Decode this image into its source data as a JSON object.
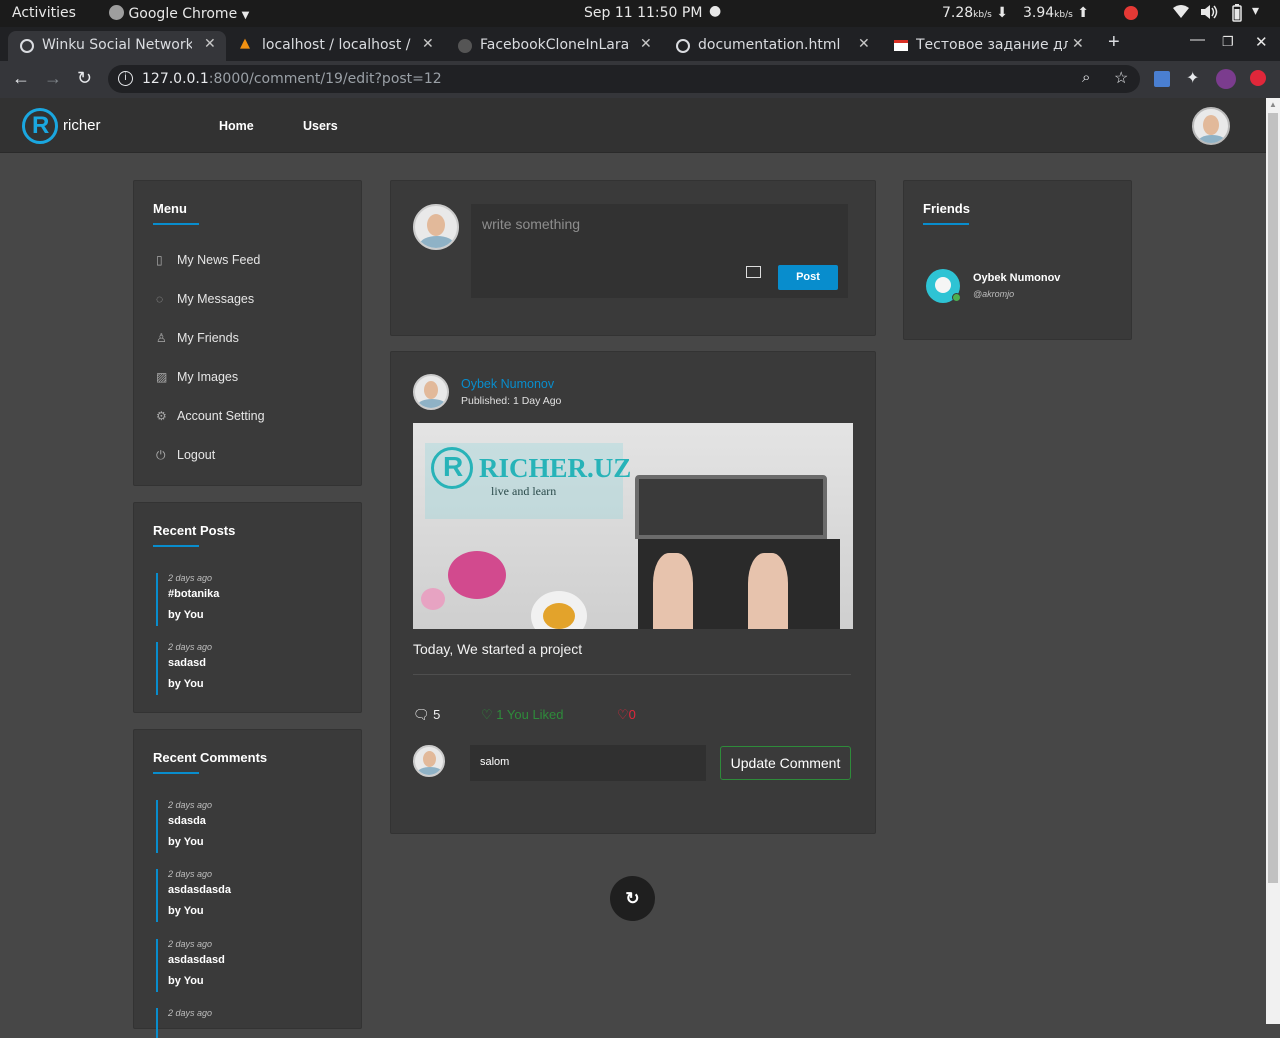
{
  "os_bar": {
    "activities": "Activities",
    "app": "Google Chrome",
    "datetime": "Sep 11  11:50 PM",
    "down_speed": "7.28",
    "down_unit": "kb/s",
    "up_speed": "3.94",
    "up_unit": "kb/s"
  },
  "tabs": [
    {
      "title": "Winku Social Network"
    },
    {
      "title": "localhost / localhost / "
    },
    {
      "title": "FacebookCloneInLarav"
    },
    {
      "title": "documentation.html"
    },
    {
      "title": "Тестовое задание для"
    }
  ],
  "address": {
    "host": "127.0.0.1",
    "path": ":8000/comment/19/edit?post=12"
  },
  "site": {
    "brand": "richer",
    "nav": [
      "Home",
      "Users"
    ]
  },
  "sidebar": {
    "menu_title": "Menu",
    "menu": [
      {
        "label": "My News Feed",
        "icon": "clipboard-icon"
      },
      {
        "label": "My Messages",
        "icon": "chat-icon"
      },
      {
        "label": "My Friends",
        "icon": "user-icon"
      },
      {
        "label": "My Images",
        "icon": "image-icon"
      },
      {
        "label": "Account Setting",
        "icon": "gear-icon"
      },
      {
        "label": "Logout",
        "icon": "power-icon"
      }
    ],
    "recent_posts_title": "Recent Posts",
    "recent_posts": [
      {
        "ago": "2 days ago",
        "text": "#botanika",
        "by": "by You"
      },
      {
        "ago": "2 days ago",
        "text": "sadasd",
        "by": "by You"
      }
    ],
    "recent_comments_title": "Recent Comments",
    "recent_comments": [
      {
        "ago": "2 days ago",
        "text": "sdasda",
        "by": "by You"
      },
      {
        "ago": "2 days ago",
        "text": "asdasdasda",
        "by": "by You"
      },
      {
        "ago": "2 days ago",
        "text": "asdasdasd",
        "by": "by You"
      },
      {
        "ago": "2 days ago"
      }
    ]
  },
  "composer": {
    "placeholder": "write something",
    "post_button": "Post"
  },
  "post": {
    "author": "Oybek Numonov",
    "published": "Published: 1 Day Ago",
    "image_brand": "RICHER.UZ",
    "image_tagline": "live and learn",
    "text": "Today, We started a project",
    "comments_count": "5",
    "likes": "1 You Liked",
    "dislikes": "0",
    "comment_value": "salom",
    "update_button": "Update Comment"
  },
  "friends": {
    "title": "Friends",
    "items": [
      {
        "name": "Oybek Numonov",
        "handle": "@akromjo"
      }
    ]
  },
  "colors": {
    "accent": "#088dcd",
    "like": "#2e8b3a",
    "dislike": "#e0273a"
  }
}
